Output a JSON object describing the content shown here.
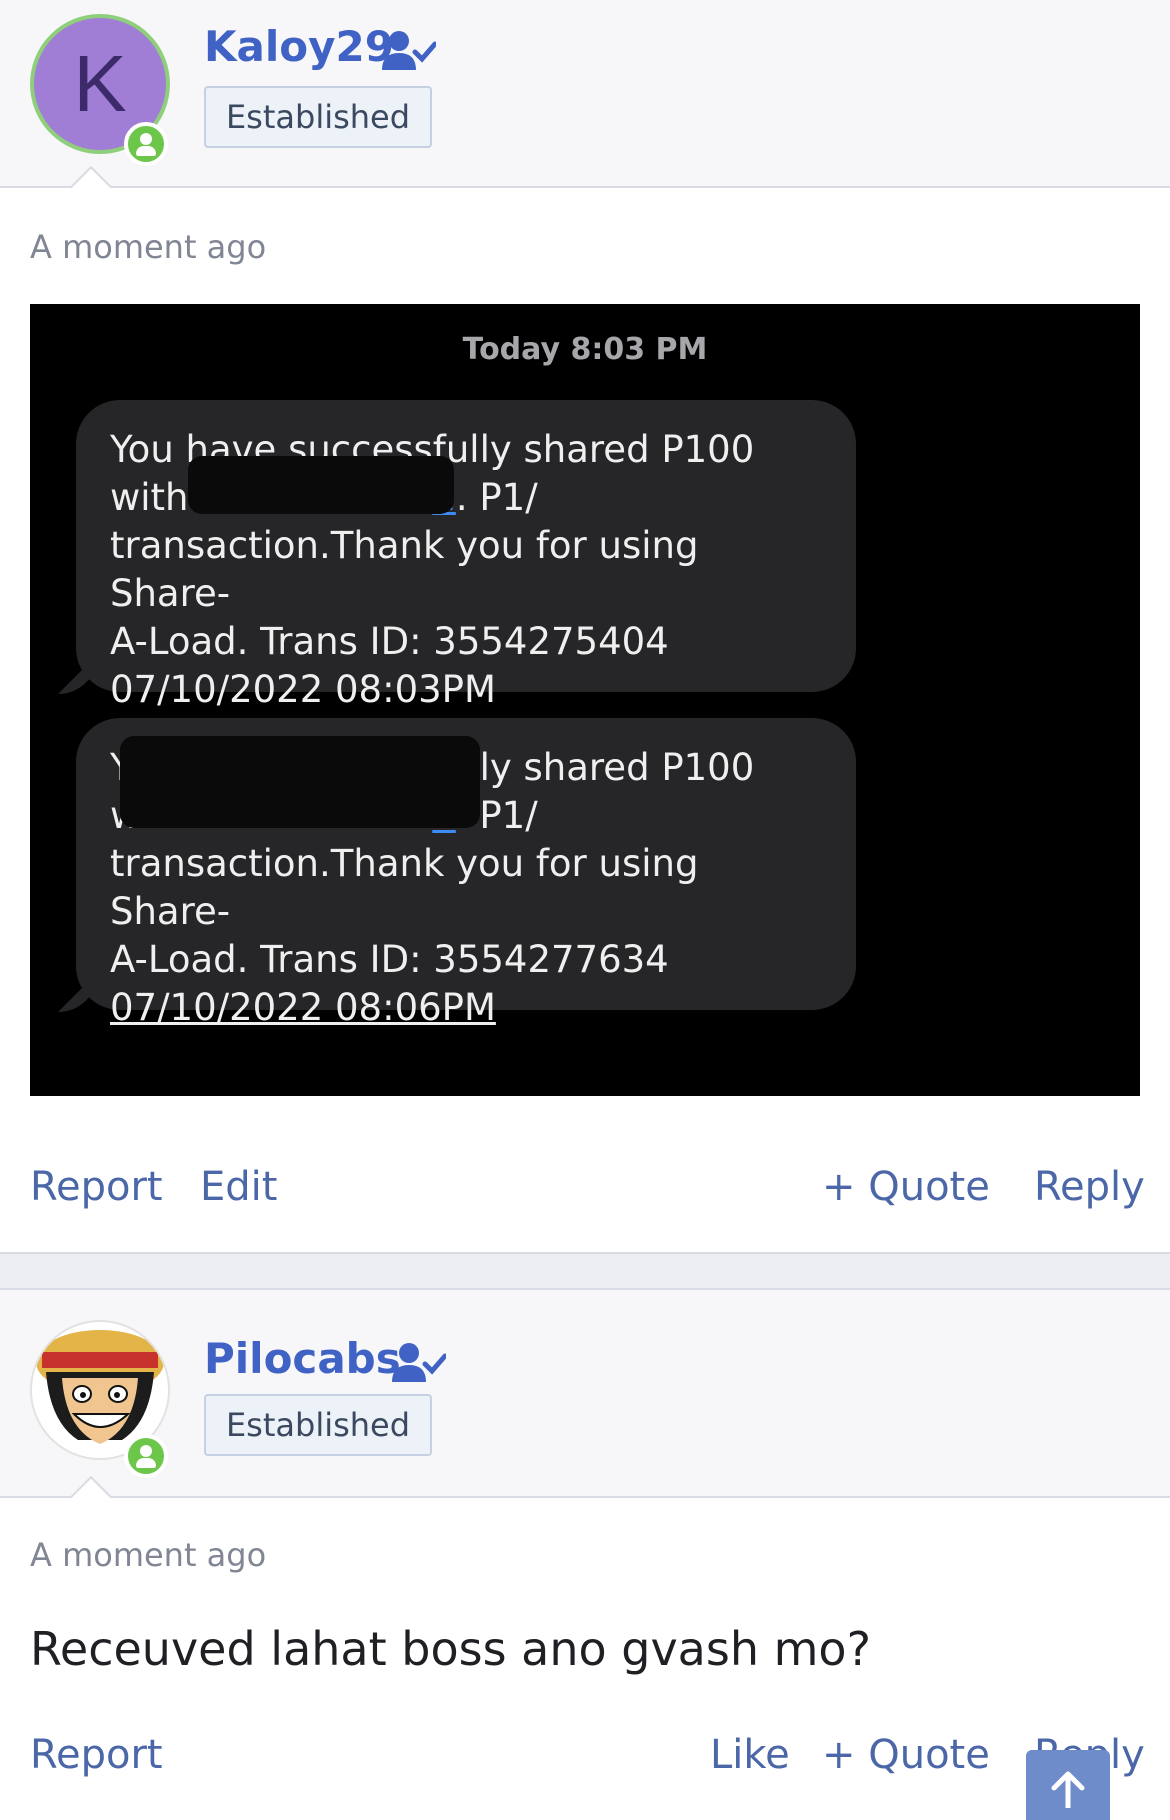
{
  "posts": [
    {
      "author": "Kaloy29",
      "avatar_letter": "K",
      "badge": "Established",
      "time": "A moment ago",
      "attachment": {
        "time_header": "Today 8:03 PM",
        "messages": [
          {
            "line1": "You have successfully shared P100",
            "line2_prefix": "with ",
            "line2_link": "1",
            "line2_suffix": ". P1/",
            "line3": "transaction.Thank you for using Share-",
            "line4": "A-Load. Trans ID: 3554275404",
            "line5": "07/10/2022 08:03PM"
          },
          {
            "line1": "You have successfully shared P100",
            "line2_prefix": "with ",
            "line2_link": "1",
            "line2_suffix": ". P1/",
            "line3": "transaction.Thank you for using Share-",
            "line4": "A-Load. Trans ID: 3554277634",
            "line5": "07/10/2022 08:06PM"
          }
        ]
      },
      "actions": {
        "report": "Report",
        "edit": "Edit",
        "quote": "+ Quote",
        "reply": "Reply"
      }
    },
    {
      "author": "Pilocabs",
      "badge": "Established",
      "time": "A moment ago",
      "text": "Receuved lahat boss ano gvash mo?",
      "actions": {
        "report": "Report",
        "like": "Like",
        "quote": "+ Quote",
        "reply": "Reply"
      }
    }
  ],
  "colors": {
    "accent": "#3f62c4",
    "link": "#4b67a8",
    "online": "#6cc64a"
  },
  "icons": [
    "user-check-icon",
    "online-status-icon",
    "plus-icon",
    "arrow-up-icon"
  ]
}
